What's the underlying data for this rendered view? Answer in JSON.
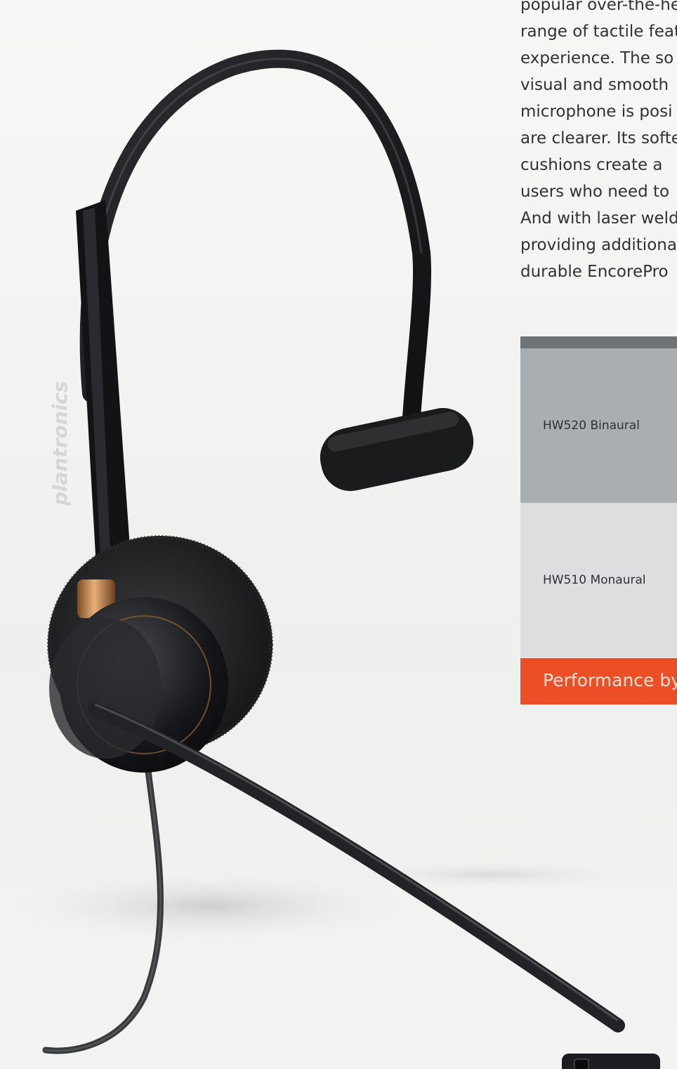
{
  "product_photo": {
    "brand_logo": "plantronics"
  },
  "description": {
    "lines": [
      "popular over-the-he",
      "range of tactile featu",
      "experience. The so",
      "visual and smooth",
      "microphone is posi",
      "are clearer. Its softe",
      "cushions create a",
      "users who need to",
      "And with laser weldi",
      "providing additiona",
      "durable EncorePro"
    ]
  },
  "models_table": {
    "rows": [
      {
        "label": "HW520 Binaural"
      },
      {
        "label": "HW510 Monaural"
      }
    ]
  },
  "cta": {
    "label": "Performance by"
  },
  "colors": {
    "accent": "#ec4e25",
    "table_header": "#6e7378",
    "row_dark": "#a9aeb3",
    "row_light": "#dcdee0"
  }
}
